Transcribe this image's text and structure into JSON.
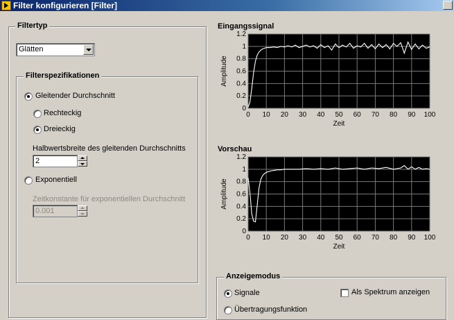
{
  "window": {
    "title": "Filter konfigurieren [Filter]"
  },
  "filtertyp": {
    "label": "Filtertyp",
    "selected": "Glätten"
  },
  "filterspez": {
    "label": "Filterspezifikationen",
    "gleitend": "Gleitender Durchschnitt",
    "rechteckig": "Rechteckig",
    "dreieckig": "Dreieckig",
    "halbwert_label": "Halbwertsbreite des gleitenden Durchschnitts",
    "halbwert_value": "2",
    "exponentiell": "Exponentiell",
    "zeitkonst_label": "Zeitkonstante für exponentiellen Durchschnitt",
    "zeitkonst_value": "0.001"
  },
  "selection": {
    "method": "gleitend",
    "window": "dreieckig",
    "mode": "signale",
    "spectrum": false
  },
  "anzeige": {
    "label": "Anzeigemodus",
    "signale": "Signale",
    "uebertragung": "Übertragungsfunktion",
    "spektrum": "Als Spektrum anzeigen"
  },
  "colors": {
    "plot_bg": "#000000",
    "trace": "#ffffff",
    "grid": "#7a7a7a",
    "panel": "#d4d0c8",
    "titlebar": "#0a246a"
  },
  "chart_data": [
    {
      "type": "line",
      "title": "Eingangssignal",
      "xlabel": "Zeit",
      "ylabel": "Amplitude",
      "xlim": [
        0,
        100
      ],
      "ylim": [
        0,
        1.2
      ],
      "x_ticks": [
        0,
        10,
        20,
        30,
        40,
        50,
        60,
        70,
        80,
        90,
        100
      ],
      "y_ticks": [
        0,
        0.2,
        0.4,
        0.6,
        0.8,
        1,
        1.2
      ],
      "x_tick_labels": [
        "0",
        "10",
        "20",
        "30",
        "40",
        "50",
        "60",
        "70",
        "80",
        "90",
        "100"
      ],
      "y_tick_labels": [
        "0",
        "0.2",
        "0.4",
        "0.6",
        "0.8",
        "1",
        "1.2"
      ],
      "grid": true,
      "series": [
        {
          "x": [
            0,
            1,
            2,
            3,
            4,
            5,
            6,
            7,
            8,
            9,
            10,
            12,
            14,
            16,
            18,
            20,
            22,
            24,
            26,
            28,
            30,
            32,
            34,
            36,
            38,
            40,
            42,
            44,
            46,
            48,
            50,
            52,
            54,
            56,
            58,
            60,
            62,
            64,
            66,
            68,
            70,
            72,
            74,
            76,
            78,
            80,
            82,
            84,
            86,
            88,
            90,
            92,
            94,
            96,
            98,
            100
          ],
          "y": [
            0.02,
            0.1,
            0.32,
            0.58,
            0.76,
            0.86,
            0.91,
            0.94,
            0.96,
            0.97,
            0.98,
            0.98,
            0.99,
            0.98,
            1.0,
            0.99,
            1.01,
            0.99,
            1.02,
            0.98,
            1.0,
            1.02,
            0.99,
            1.01,
            0.97,
            1.03,
            0.98,
            1.01,
            0.94,
            1.04,
            0.98,
            1.02,
            0.99,
            1.05,
            0.97,
            1.01,
            0.99,
            1.05,
            0.97,
            1.03,
            0.96,
            1.04,
            0.98,
            1.03,
            0.96,
            1.05,
            1.0,
            1.06,
            0.89,
            1.07,
            0.95,
            1.04,
            0.96,
            1.02,
            0.97,
            0.99
          ]
        }
      ]
    },
    {
      "type": "line",
      "title": "Vorschau",
      "xlabel": "Zeit",
      "ylabel": "Amplitude",
      "xlim": [
        0,
        100
      ],
      "ylim": [
        0,
        1.2
      ],
      "x_ticks": [
        0,
        10,
        20,
        30,
        40,
        50,
        60,
        70,
        80,
        90,
        100
      ],
      "y_ticks": [
        0,
        0.2,
        0.4,
        0.6,
        0.8,
        1,
        1.2
      ],
      "x_tick_labels": [
        "0",
        "10",
        "20",
        "30",
        "40",
        "50",
        "60",
        "70",
        "80",
        "90",
        "100"
      ],
      "y_tick_labels": [
        "0",
        "0.2",
        "0.4",
        "0.6",
        "0.8",
        "1",
        "1.2"
      ],
      "grid": true,
      "series": [
        {
          "x": [
            0,
            1,
            2,
            3,
            4,
            5,
            6,
            7,
            8,
            9,
            10,
            12,
            14,
            16,
            18,
            20,
            24,
            28,
            32,
            36,
            40,
            44,
            48,
            52,
            56,
            60,
            64,
            68,
            72,
            76,
            80,
            84,
            86,
            88,
            90,
            92,
            94,
            96,
            98,
            100
          ],
          "y": [
            0.86,
            0.62,
            0.28,
            0.16,
            0.15,
            0.42,
            0.7,
            0.84,
            0.9,
            0.93,
            0.95,
            0.97,
            0.98,
            0.99,
            0.99,
            1.0,
            1.0,
            1.0,
            1.01,
            1.0,
            1.01,
            1.0,
            1.02,
            1.0,
            1.01,
            1.02,
            1.0,
            1.02,
            1.01,
            1.03,
            1.0,
            1.02,
            1.06,
            1.0,
            1.04,
            1.0,
            1.03,
            1.0,
            1.01,
            1.0
          ]
        }
      ]
    }
  ]
}
